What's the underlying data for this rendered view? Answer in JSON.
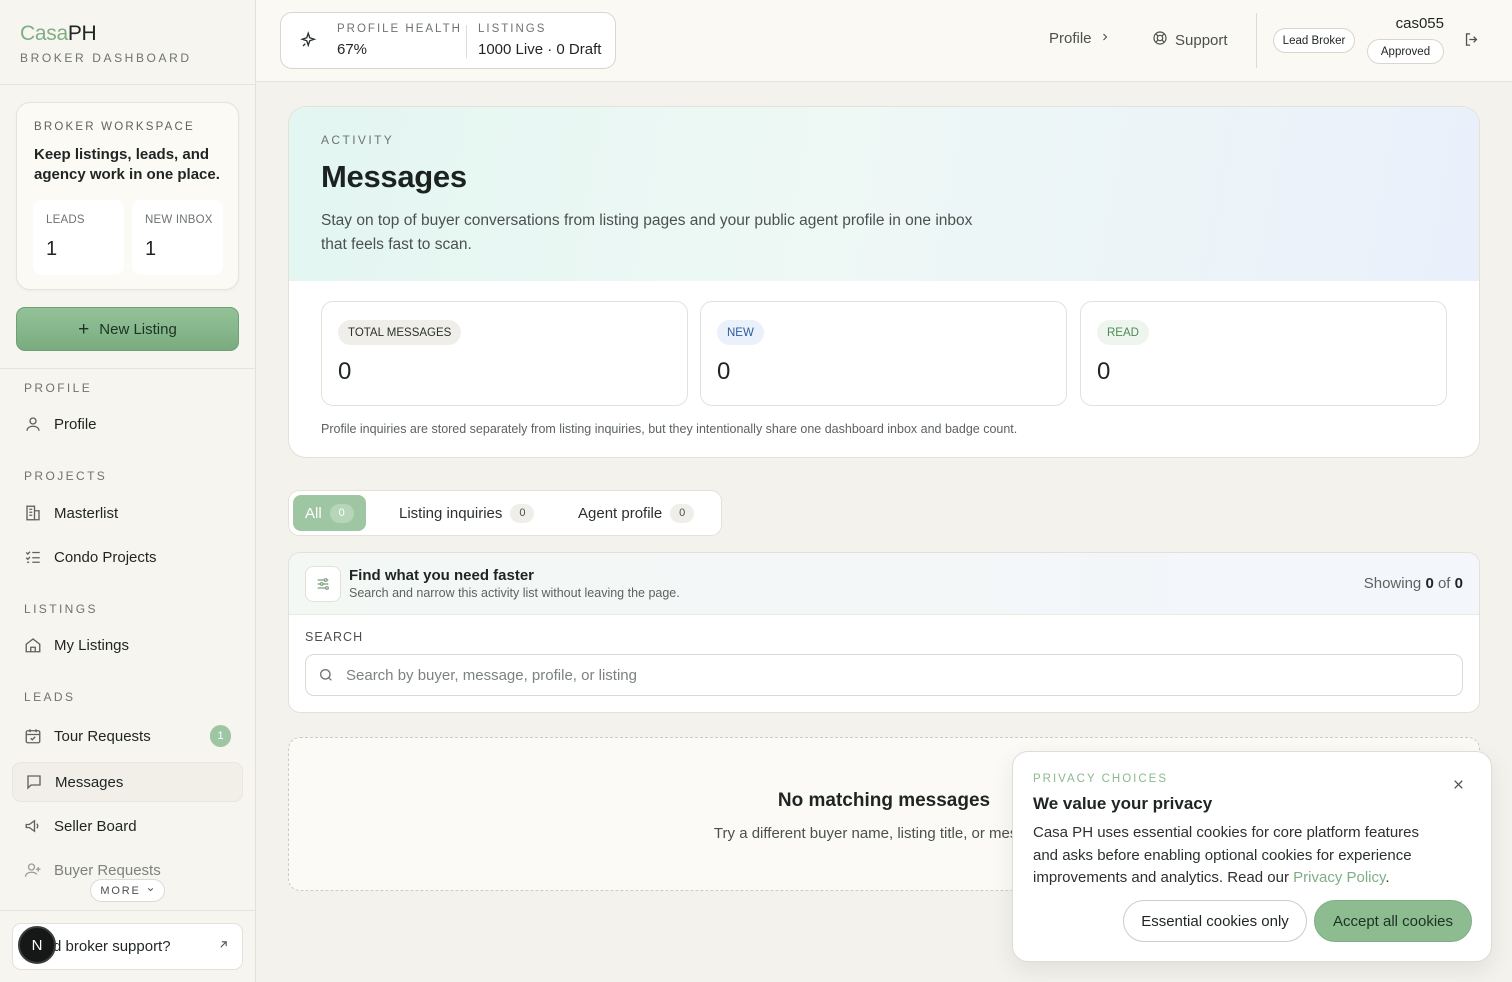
{
  "brand": {
    "casa": "Casa",
    "ph": "PH",
    "subtitle": "BROKER DASHBOARD"
  },
  "workspace": {
    "eyebrow": "BROKER WORKSPACE",
    "title": "Keep listings, leads, and agency work in one place.",
    "leads_label": "LEADS",
    "leads_value": "1",
    "inbox_label": "NEW INBOX",
    "inbox_value": "1"
  },
  "new_listing": {
    "icon": "plus-icon",
    "label": "New Listing"
  },
  "nav": {
    "profile_section": "PROFILE",
    "profile": "Profile",
    "projects_section": "PROJECTS",
    "masterlist": "Masterlist",
    "condo_projects": "Condo Projects",
    "listings_section": "LISTINGS",
    "my_listings": "My Listings",
    "leads_section": "LEADS",
    "tour_requests": "Tour Requests",
    "tour_requests_badge": "1",
    "messages": "Messages",
    "seller_board": "Seller Board",
    "buyer_requests": "Buyer Requests",
    "more": "MORE"
  },
  "support": {
    "text": "d broker support?",
    "avatar_letter": "N"
  },
  "topbar": {
    "health_label": "PROFILE HEALTH",
    "health_value": "67%",
    "listings_label": "LISTINGS",
    "listings_value": "1000 Live · 0 Draft",
    "profile_link": "Profile",
    "support_link": "Support",
    "role_badge": "Lead Broker",
    "username": "cas055",
    "status_badge": "Approved"
  },
  "hero": {
    "eyebrow": "ACTIVITY",
    "title": "Messages",
    "description": "Stay on top of buyer conversations from listing pages and your public agent profile in one inbox that feels fast to scan.",
    "stats": [
      {
        "label": "TOTAL MESSAGES",
        "value": "0"
      },
      {
        "label": "NEW",
        "value": "0"
      },
      {
        "label": "READ",
        "value": "0"
      }
    ],
    "note": "Profile inquiries are stored separately from listing inquiries, but they intentionally share one dashboard inbox and badge count."
  },
  "tabs": [
    {
      "label": "All",
      "count": "0"
    },
    {
      "label": "Listing inquiries",
      "count": "0"
    },
    {
      "label": "Agent profile",
      "count": "0"
    }
  ],
  "filter": {
    "title": "Find what you need faster",
    "subtitle": "Search and narrow this activity list without leaving the page.",
    "showing_prefix": "Showing",
    "showing_count": "0",
    "showing_of": "of",
    "showing_total": "0",
    "search_label": "SEARCH",
    "search_placeholder": "Search by buyer, message, profile, or listing",
    "search_value": ""
  },
  "empty": {
    "title": "No matching messages",
    "subtitle": "Try a different buyer name, listing title, or message."
  },
  "cookie": {
    "eyebrow": "PRIVACY CHOICES",
    "title": "We value your privacy",
    "text": "Casa PH uses essential cookies for core platform features and asks before enabling optional cookies for experience improvements and analytics. Read our",
    "link": "Privacy Policy",
    "essential": "Essential cookies only",
    "accept": "Accept all cookies"
  },
  "colors": {
    "accent": "#8cbc90",
    "accent_dark": "#7fae86",
    "badge_new": "#2a5c9e",
    "badge_read": "#4e8b57"
  }
}
